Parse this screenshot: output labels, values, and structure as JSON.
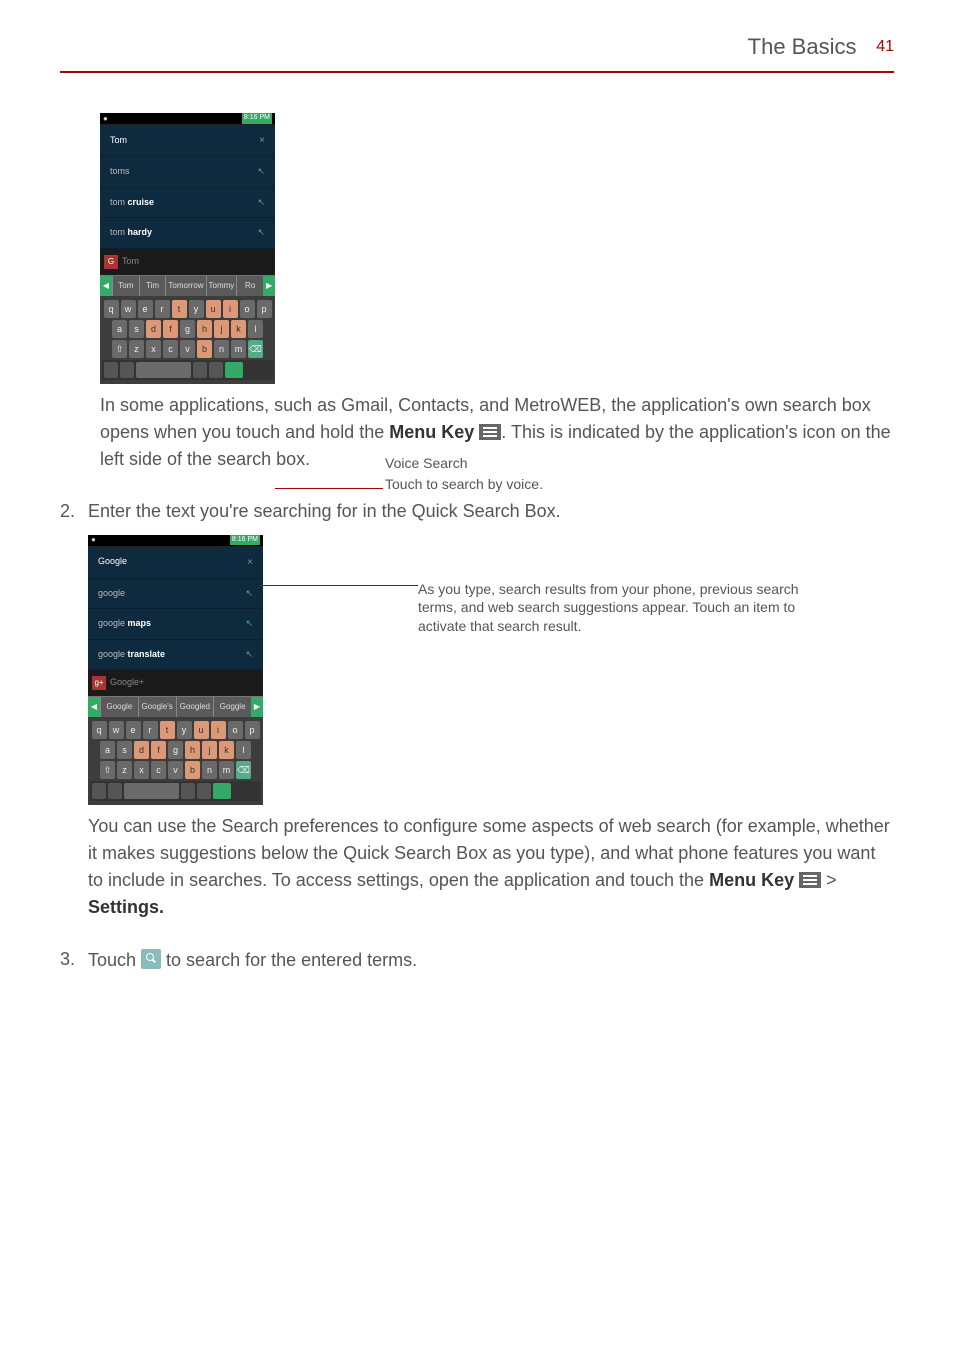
{
  "header": {
    "title": "The Basics",
    "page_number": "41"
  },
  "screenshot1": {
    "statusbar_time": "8:16 PM",
    "suggestions": [
      "Tom",
      "toms",
      "tom cruise",
      "tom hardy"
    ],
    "search_text": "Tom",
    "predictions": [
      "Tom",
      "Tim",
      "Tomorrow",
      "Tommy",
      "Ro"
    ],
    "keyboard": {
      "row1": [
        "q",
        "w",
        "e",
        "r",
        "t",
        "y",
        "u",
        "i",
        "o",
        "p"
      ],
      "row2": [
        "a",
        "s",
        "d",
        "f",
        "g",
        "h",
        "j",
        "k",
        "l"
      ],
      "row3": [
        "z",
        "x",
        "c",
        "v",
        "b",
        "n",
        "m"
      ]
    }
  },
  "voice_callout": {
    "title": "Voice Search",
    "desc": "Touch to search by voice."
  },
  "para1": {
    "t1": "In some applications, such as Gmail, Contacts, and MetroWEB, the application's own search box opens when you touch and hold the ",
    "bold1": "Menu Key",
    "t2": ". This is indicated by the application's icon on the left side of the search box."
  },
  "step2": {
    "num": "2.",
    "text": "Enter the text you're searching for in the Quick Search Box."
  },
  "screenshot2": {
    "statusbar_time": "8:16 PM",
    "suggestions": [
      "Google",
      "google",
      "google maps",
      "google translate"
    ],
    "search_text": "Google+",
    "predictions": [
      "Google",
      "Google's",
      "Googled",
      "Goggle"
    ],
    "keyboard": {
      "row1": [
        "q",
        "w",
        "e",
        "r",
        "t",
        "y",
        "u",
        "i",
        "o",
        "p"
      ],
      "row2": [
        "a",
        "s",
        "d",
        "f",
        "g",
        "h",
        "j",
        "k",
        "l"
      ],
      "row3": [
        "z",
        "x",
        "c",
        "v",
        "b",
        "n",
        "m"
      ]
    }
  },
  "annotation": "As you type, search results from your phone, previous search terms, and web search suggestions appear. Touch an item to activate that search result.",
  "para2": {
    "t1": "You can use the Search preferences to configure some aspects of web search (for example, whether it makes suggestions below the Quick Search Box as you type), and what phone features you want to include in searches. To access settings, open the application and touch the ",
    "bold1": "Menu Key ",
    "t2": " > ",
    "bold2": "Settings."
  },
  "step3": {
    "num": "3.",
    "t1": "Touch ",
    "t2": " to search for the entered terms."
  }
}
